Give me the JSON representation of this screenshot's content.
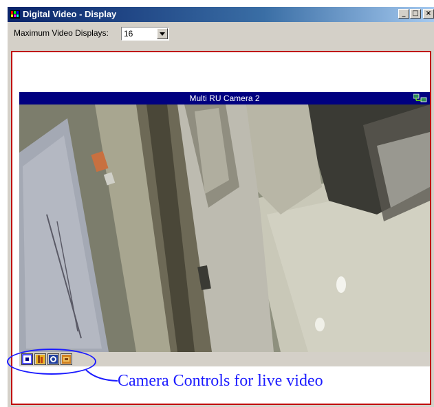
{
  "window": {
    "title": "Digital Video - Display",
    "minimize_glyph": "_",
    "maximize_glyph": "□",
    "close_glyph": "×"
  },
  "toolbar": {
    "max_displays_label": "Maximum Video Displays:",
    "max_displays_value": "16"
  },
  "camera": {
    "title": "Multi RU Camera 2",
    "status_icon": "network-connected-icon"
  },
  "camera_controls": {
    "buttons": [
      {
        "icon": "snapshot-icon"
      },
      {
        "icon": "record-icon"
      },
      {
        "icon": "settings-icon"
      },
      {
        "icon": "zoom-icon"
      }
    ]
  },
  "annotation": {
    "callout": "Camera Controls for live video",
    "color": "#1c1cff"
  },
  "colors": {
    "title_bar": "#0a246a",
    "camera_header": "#000080",
    "display_border": "#c00000"
  }
}
